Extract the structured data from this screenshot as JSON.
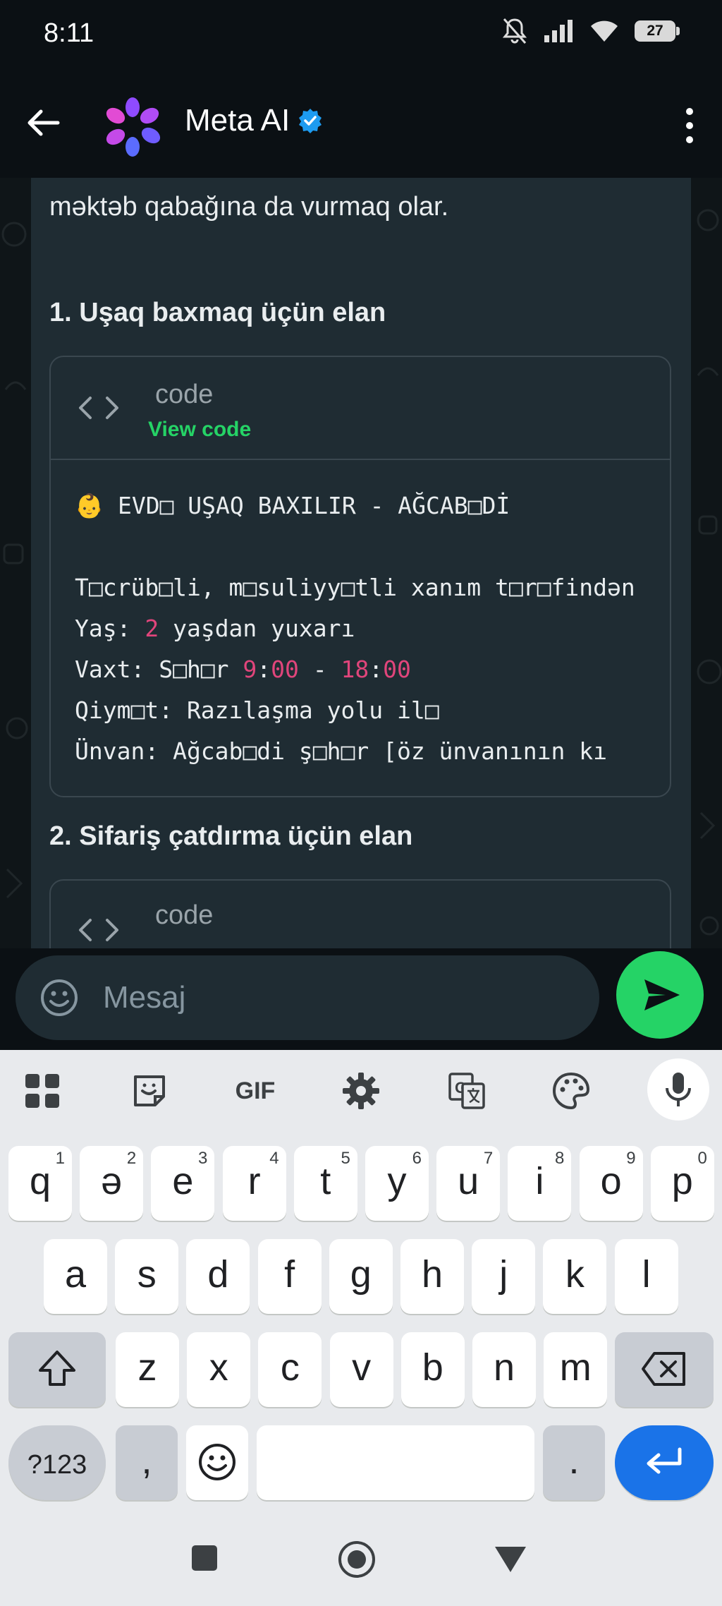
{
  "status_bar": {
    "time": "8:11",
    "battery": "27"
  },
  "header": {
    "title": "Meta AI"
  },
  "message": {
    "intro_text": "məktəb qabağına da vurmaq olar.",
    "heading1": "1. Uşaq baxmaq üçün elan",
    "heading2": "2. Sifariş çatdırma üçün elan",
    "code_block_1": {
      "label": "code",
      "view_code": "View code",
      "lines": [
        [
          {
            "t": "👶 EVD□ UŞAQ BAXILIR - AĞCAB□Dİ",
            "n": false
          }
        ],
        [
          {
            "t": "",
            "n": false
          }
        ],
        [
          {
            "t": "T□crüb□li, m□suliyy□tli xanım t□r□findən",
            "n": false
          }
        ],
        [
          {
            "t": "Yaş: ",
            "n": false
          },
          {
            "t": "2",
            "n": true
          },
          {
            "t": " yaşdan yuxarı",
            "n": false
          }
        ],
        [
          {
            "t": "Vaxt: S□h□r ",
            "n": false
          },
          {
            "t": "9",
            "n": true
          },
          {
            "t": ":",
            "n": false
          },
          {
            "t": "00",
            "n": true
          },
          {
            "t": " - ",
            "n": false
          },
          {
            "t": "18",
            "n": true
          },
          {
            "t": ":",
            "n": false
          },
          {
            "t": "00",
            "n": true
          }
        ],
        [
          {
            "t": "Qiym□t: Razılaşma yolu il□",
            "n": false
          }
        ],
        [
          {
            "t": "Ünvan: Ağcab□di ş□h□r [öz ünvanının kı",
            "n": false
          }
        ]
      ]
    },
    "code_block_2": {
      "label": "code"
    }
  },
  "composer": {
    "placeholder": "Mesaj"
  },
  "keyboard": {
    "toolbar": {
      "gif_label": "GIF"
    },
    "row1": [
      {
        "k": "q",
        "s": "1"
      },
      {
        "k": "ə",
        "s": "2"
      },
      {
        "k": "e",
        "s": "3"
      },
      {
        "k": "r",
        "s": "4"
      },
      {
        "k": "t",
        "s": "5"
      },
      {
        "k": "y",
        "s": "6"
      },
      {
        "k": "u",
        "s": "7"
      },
      {
        "k": "i",
        "s": "8"
      },
      {
        "k": "o",
        "s": "9"
      },
      {
        "k": "p",
        "s": "0"
      }
    ],
    "row2": [
      "a",
      "s",
      "d",
      "f",
      "g",
      "h",
      "j",
      "k",
      "l"
    ],
    "row3": [
      "z",
      "x",
      "c",
      "v",
      "b",
      "n",
      "m"
    ],
    "symbols_label": "?123",
    "comma": ",",
    "period": "."
  },
  "colors": {
    "accent": "#25d366",
    "bubble": "#1f2c33",
    "number_highlight": "#e0457b",
    "keyboard_blue": "#1a73e8"
  }
}
